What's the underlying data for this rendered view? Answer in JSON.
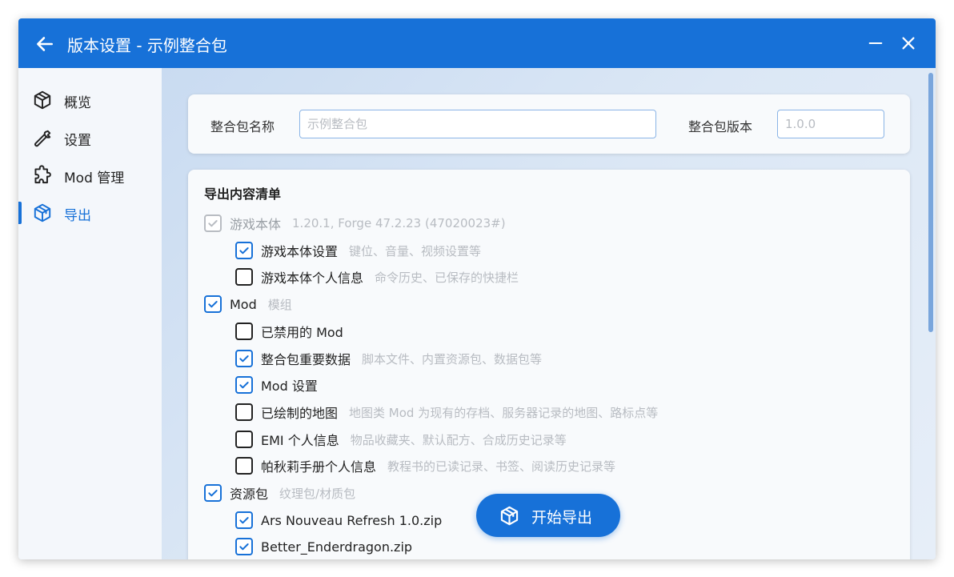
{
  "window": {
    "title": "版本设置 - 示例整合包"
  },
  "colors": {
    "accent": "#1771d8",
    "sidebar_bg": "#f4f7fb",
    "muted_text": "#b8bcc2"
  },
  "sidebar": {
    "items": [
      {
        "label": "概览",
        "icon": "cube-outline-icon",
        "active": false
      },
      {
        "label": "设置",
        "icon": "wrench-icon",
        "active": false
      },
      {
        "label": "Mod 管理",
        "icon": "puzzle-icon",
        "active": false
      },
      {
        "label": "导出",
        "icon": "package-icon",
        "active": true
      }
    ]
  },
  "modpack": {
    "name_label": "整合包名称",
    "name_placeholder": "示例整合包",
    "version_label": "整合包版本",
    "version_placeholder": "1.0.0"
  },
  "export_list": {
    "title": "导出内容清单",
    "items": [
      {
        "label": "游戏本体",
        "desc": "1.20.1, Forge 47.2.23 (47020023#)",
        "checked": true,
        "disabled": true,
        "level": 0
      },
      {
        "label": "游戏本体设置",
        "desc": "键位、音量、视频设置等",
        "checked": true,
        "disabled": false,
        "level": 1
      },
      {
        "label": "游戏本体个人信息",
        "desc": "命令历史、已保存的快捷栏",
        "checked": false,
        "disabled": false,
        "level": 1
      },
      {
        "label": "Mod",
        "desc": "模组",
        "checked": true,
        "disabled": false,
        "level": 0
      },
      {
        "label": "已禁用的 Mod",
        "desc": "",
        "checked": false,
        "disabled": false,
        "level": 1
      },
      {
        "label": "整合包重要数据",
        "desc": "脚本文件、内置资源包、数据包等",
        "checked": true,
        "disabled": false,
        "level": 1
      },
      {
        "label": "Mod 设置",
        "desc": "",
        "checked": true,
        "disabled": false,
        "level": 1
      },
      {
        "label": "已绘制的地图",
        "desc": "地图类 Mod 为现有的存档、服务器记录的地图、路标点等",
        "checked": false,
        "disabled": false,
        "level": 1
      },
      {
        "label": "EMI 个人信息",
        "desc": "物品收藏夹、默认配方、合成历史记录等",
        "checked": false,
        "disabled": false,
        "level": 1
      },
      {
        "label": "帕秋莉手册个人信息",
        "desc": "教程书的已读记录、书签、阅读历史记录等",
        "checked": false,
        "disabled": false,
        "level": 1
      },
      {
        "label": "资源包",
        "desc": "纹理包/材质包",
        "checked": true,
        "disabled": false,
        "level": 0
      },
      {
        "label": "Ars Nouveau Refresh 1.0.zip",
        "desc": "",
        "checked": true,
        "disabled": false,
        "level": 1
      },
      {
        "label": "Better_Enderdragon.zip",
        "desc": "",
        "checked": true,
        "disabled": false,
        "level": 1
      }
    ]
  },
  "start_export": {
    "label": "开始导出",
    "icon": "package-icon"
  }
}
